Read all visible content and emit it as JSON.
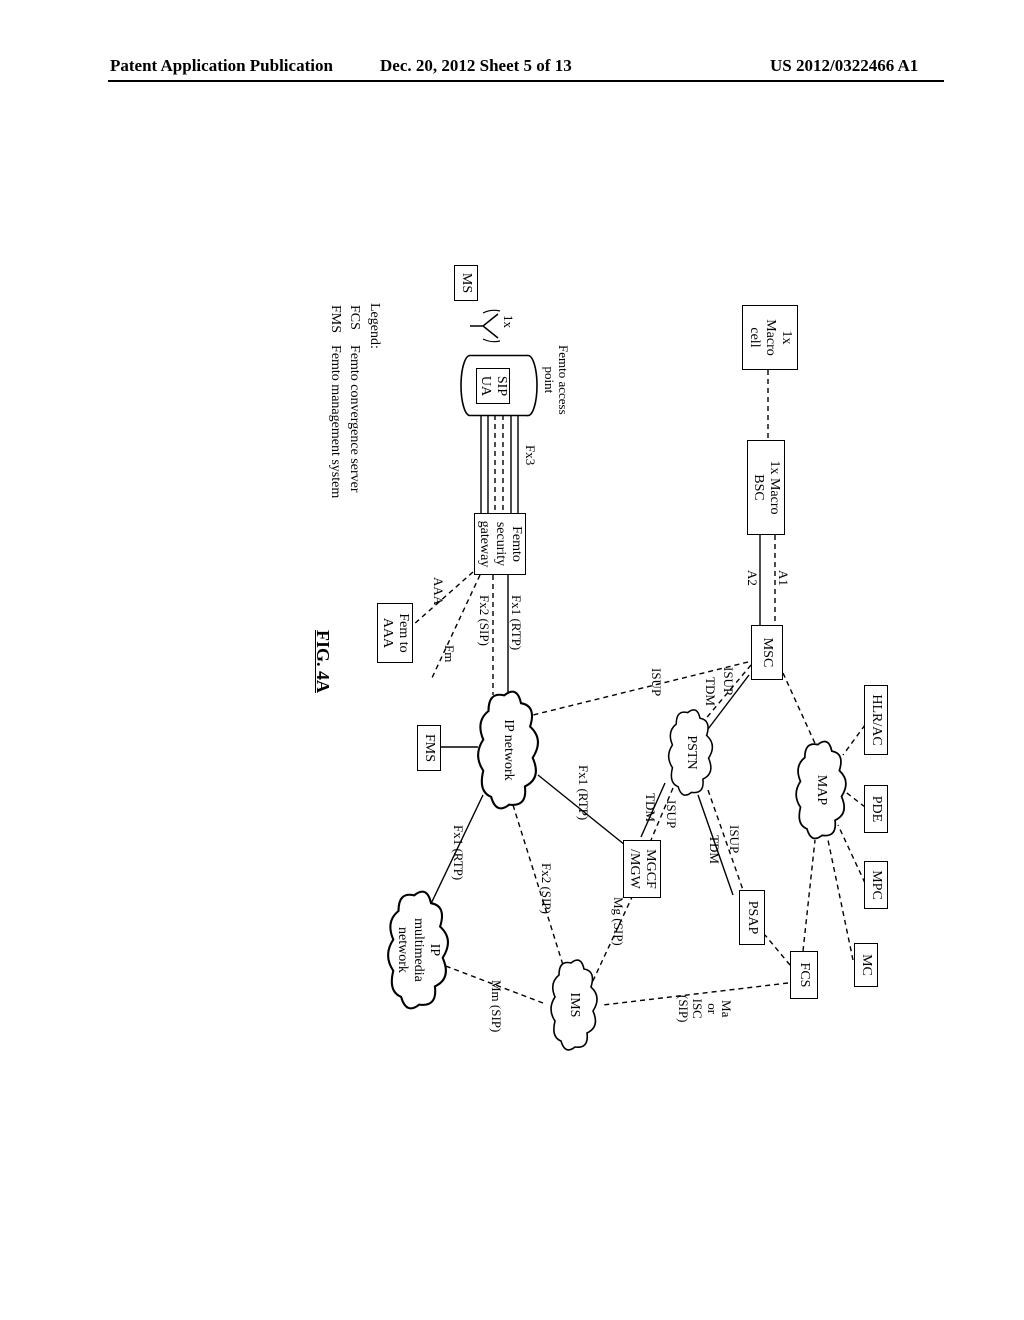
{
  "header": {
    "left": "Patent Application Publication",
    "center": "Dec. 20, 2012  Sheet 5 of 13",
    "right": "US 2012/0322466 A1"
  },
  "nodes": {
    "macro_cell": "1x\nMacro\ncell",
    "macro_bsc": "1x Macro\nBSC",
    "msc": "MSC",
    "hlr_ac": "HLR/AC",
    "pde": "PDE",
    "mpc": "MPC",
    "mc": "MC",
    "fcs": "FCS",
    "psap": "PSAP",
    "mgcf_mgw": "MGCF\n/MGW",
    "fms": "FMS",
    "femto_aaa": "Fem to\nAAA",
    "femto_sg": "Femto\nsecurity\ngateway",
    "sip_ua": "SIP\nUA",
    "ms": "MS"
  },
  "clouds": {
    "map": "MAP",
    "pstn": "PSTN",
    "ip_net": "IP network",
    "ims": "IMS",
    "ip_mm": "IP\nmultimedia\nnetwork"
  },
  "labels": {
    "a1": "A1",
    "a2": "A2",
    "isup1": "ISUP",
    "tdm1": "TDM",
    "isup2": "ISUP",
    "tdm2": "TDM",
    "isup3": "ISUP",
    "tdm3": "TDM",
    "fx1_1": "Fx1 (RTP)",
    "fx2_1": "Fx2 (SIP)",
    "fx1_2": "Fx1 (RTP)",
    "fx2_2": "Fx2 (SIP)",
    "fx1_3": "Fx1 (RTP)",
    "mg_sip": "Mg (SIP)",
    "mm_sip": "Mm (SIP)",
    "ma_isc": "Ma\nor\nISC\n(SIP)",
    "fm": "Fm",
    "aaa": "AAA",
    "fx3": "Fx3",
    "onex": "1x",
    "fap_title": "Femto access\npoint"
  },
  "legend": {
    "title": "Legend:",
    "rows": [
      {
        "k": "FCS",
        "v": "Femto convergence server"
      },
      {
        "k": "FMS",
        "v": "Femto management system"
      }
    ]
  },
  "figure_caption": "FIG. 4A"
}
